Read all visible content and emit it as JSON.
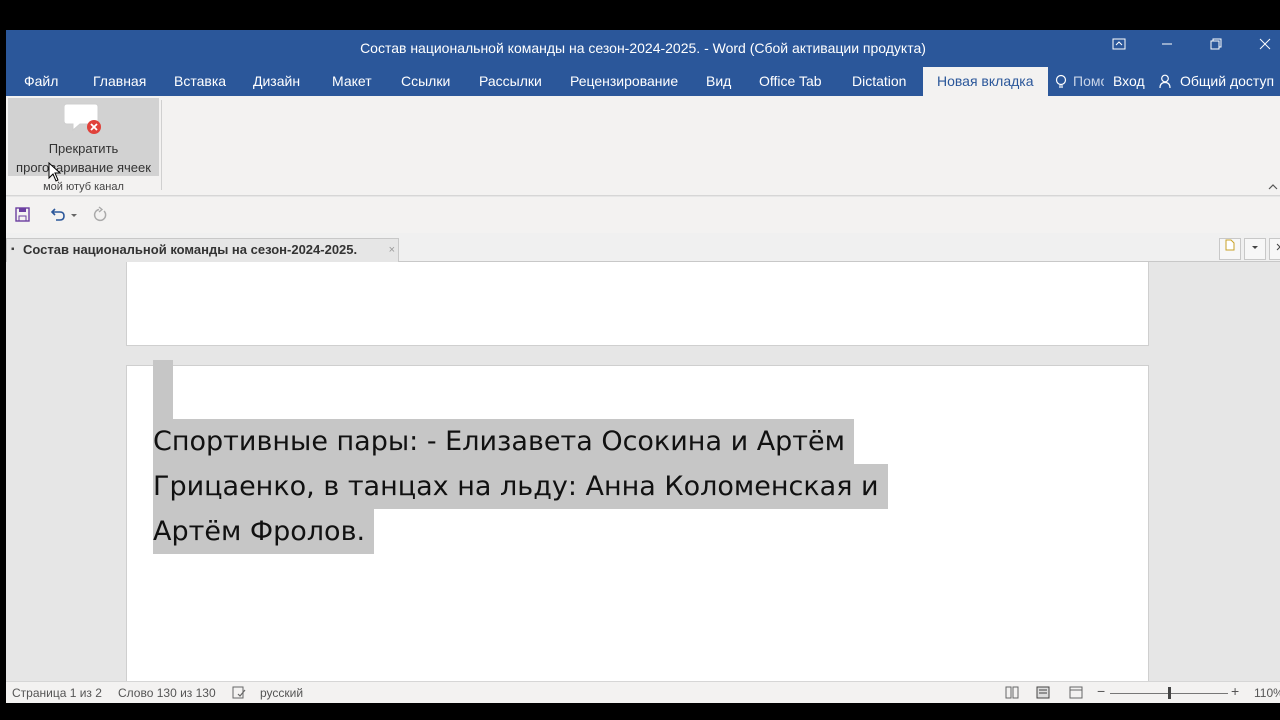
{
  "window": {
    "title": "Состав национальной команды на сезон-2024-2025. - Word (Сбой активации продукта)"
  },
  "menu": {
    "tabs": [
      "Файл",
      "Главная",
      "Вставка",
      "Дизайн",
      "Макет",
      "Ссылки",
      "Рассылки",
      "Рецензирование",
      "Вид",
      "Office Tab",
      "Dictation"
    ],
    "active_tab": "Новая вкладка",
    "tell_me": "Помощник",
    "sign_in": "Вход",
    "share": "Общий доступ"
  },
  "ribbon": {
    "button_line1": "Прекратить",
    "button_line2": "проговаривание ячеек",
    "group_label": "мой ютуб канал"
  },
  "doc_tab": {
    "title": "Состав национальной команды на сезон-2024-2025.",
    "close": "×"
  },
  "document": {
    "line1": "Спортивные пары: - Елизавета Осокина и Артём",
    "line2": "Грицаенко, в танцах на льду: Анна Коломенская и",
    "line3": "Артём Фролов."
  },
  "status": {
    "page": "Страница 1 из 2",
    "words": "Слово 130 из 130",
    "language": "русский",
    "zoom": "110%"
  },
  "colors": {
    "title_bar": "#2b579a",
    "selection": "#c6c6c6"
  }
}
